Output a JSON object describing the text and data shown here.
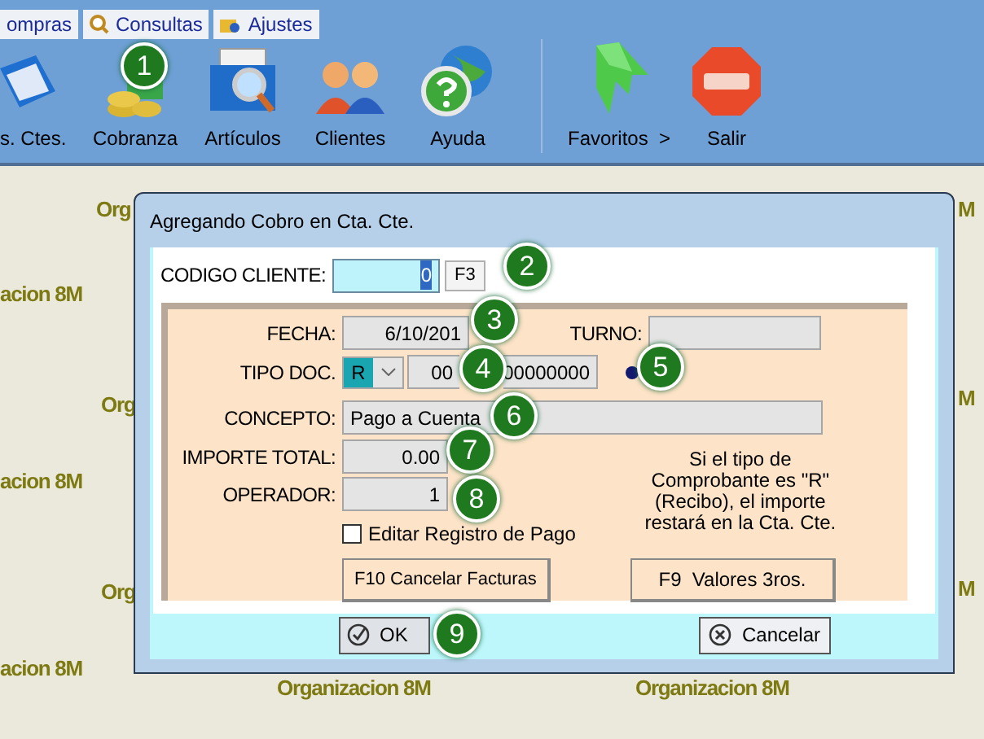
{
  "menu_tabs": [
    {
      "label": "ompras"
    },
    {
      "label": "Consultas"
    },
    {
      "label": "Ajustes"
    }
  ],
  "toolbar_groups": [
    [
      {
        "label": "s. Ctes."
      },
      {
        "label": "Cobranza"
      },
      {
        "label": "Artículos"
      },
      {
        "label": "Clientes"
      },
      {
        "label": "Ayuda"
      }
    ],
    [
      {
        "label": "Favoritos  >"
      },
      {
        "label": "Salir"
      }
    ]
  ],
  "wallpaper": [
    "Org",
    "acion 8M",
    "Org",
    "acion 8M",
    "Org",
    "acion 8M",
    "M",
    "M",
    "M",
    "Organizacion 8M",
    "Organizacion 8M"
  ],
  "dialog": {
    "title": "Agregando Cobro en Cta. Cte.",
    "codigo_cliente": {
      "label": "CODIGO CLIENTE:",
      "value": "0",
      "lookup_button": "F3"
    },
    "fecha": {
      "label": "FECHA:",
      "value": "6/10/201"
    },
    "turno": {
      "label": "TURNO:"
    },
    "tipo_doc": {
      "label": "TIPO DOC.",
      "type": "R",
      "prefix": "00",
      "number": "00000000"
    },
    "concepto": {
      "label": "CONCEPTO:",
      "value": "Pago a Cuenta"
    },
    "importe_total": {
      "label": "IMPORTE TOTAL:",
      "value": "0.00"
    },
    "operador": {
      "label": "OPERADOR:",
      "value": "1"
    },
    "editar": {
      "label": "Editar Registro de Pago",
      "checked": false
    },
    "note": "Si el tipo de Comprobante es \"R\" (Recibo), el importe restará en la Cta. Cte.",
    "buttons": [
      "F10 Cancelar Facturas",
      "F9  Valores 3ros."
    ],
    "ok": "OK",
    "cancel": "Cancelar"
  },
  "annotations": [
    "1",
    "2",
    "3",
    "4",
    "5",
    "6",
    "7",
    "8",
    "9"
  ]
}
